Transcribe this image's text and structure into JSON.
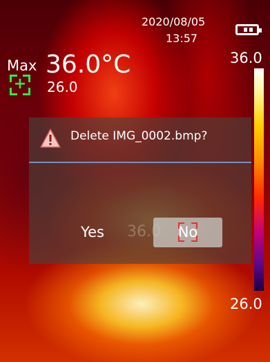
{
  "status": {
    "date": "2020/08/05",
    "time": "13:57",
    "battery_icon": "battery-icon"
  },
  "measurement": {
    "max_label": "Max",
    "max_temp": "36.0°C",
    "min_temp": "26.0",
    "spot_icon": "crosshair-plus-icon"
  },
  "scale": {
    "max": "36.0",
    "min": "26.0",
    "palette": [
      "#ffffff",
      "#ffd200",
      "#ff8a00",
      "#ff2a00",
      "#c4007a",
      "#5a0a8a",
      "#1a0040"
    ]
  },
  "dialog": {
    "icon": "warning-icon",
    "message": "Delete IMG_0002.bmp?",
    "yes_label": "Yes",
    "no_label": "No",
    "background_overlay_text": "36.0",
    "divider_color": "#7a8fb8"
  },
  "colors": {
    "spot_green": "#2ee84a",
    "target_red": "#e83030",
    "warning_red": "#d9534f"
  }
}
